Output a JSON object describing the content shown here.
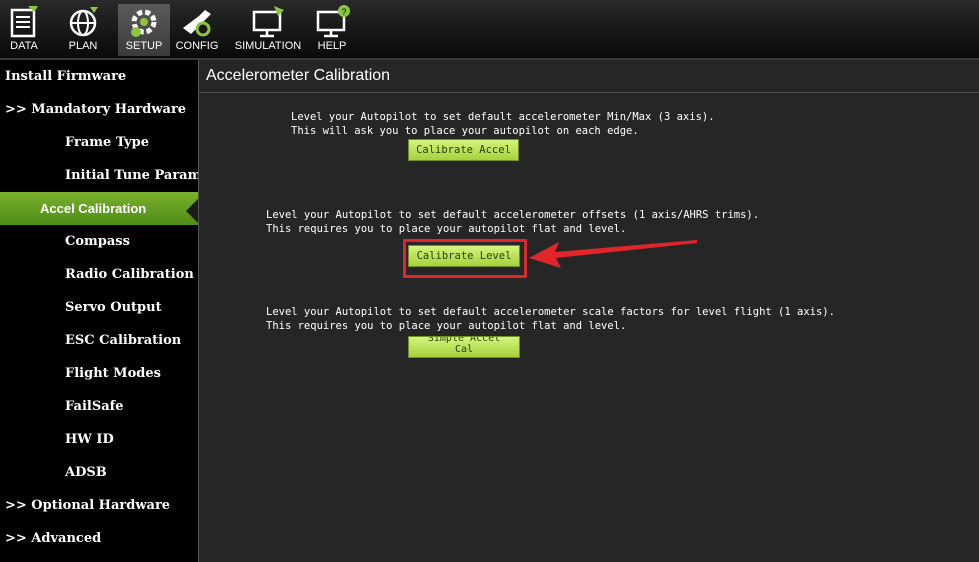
{
  "toolbar": {
    "items": [
      {
        "label": "DATA",
        "icon": "data-icon"
      },
      {
        "label": "PLAN",
        "icon": "plan-globe-icon"
      },
      {
        "label": "SETUP",
        "icon": "setup-gear-icon",
        "active": true
      },
      {
        "label": "CONFIG",
        "icon": "config-wrench-icon"
      },
      {
        "label": "SIMULATION",
        "icon": "simulation-monitor-icon"
      },
      {
        "label": "HELP",
        "icon": "help-monitor-icon"
      }
    ]
  },
  "sidebar": {
    "items": [
      {
        "label": "Install Firmware"
      },
      {
        "label": ">> Mandatory Hardware"
      },
      {
        "label": "Frame Type"
      },
      {
        "label": "Initial Tune Parameters"
      },
      {
        "label": "Accel Calibration",
        "active": true
      },
      {
        "label": "Compass"
      },
      {
        "label": "Radio Calibration"
      },
      {
        "label": "Servo Output"
      },
      {
        "label": "ESC Calibration"
      },
      {
        "label": "Flight Modes"
      },
      {
        "label": "FailSafe"
      },
      {
        "label": "HW ID"
      },
      {
        "label": "ADSB"
      },
      {
        "label": ">> Optional Hardware"
      },
      {
        "label": ">> Advanced"
      }
    ]
  },
  "main": {
    "title": "Accelerometer Calibration",
    "section1": {
      "line1": "Level your Autopilot to set default accelerometer Min/Max (3 axis).",
      "line2": "This will ask you to place your autopilot on each edge.",
      "button": "Calibrate Accel"
    },
    "section2": {
      "line1": "Level your Autopilot to set default accelerometer offsets (1 axis/AHRS trims).",
      "line2": "This requires you to place your autopilot flat and level.",
      "button": "Calibrate Level"
    },
    "section3": {
      "line1": "Level your Autopilot to set default accelerometer scale factors for level flight (1 axis).",
      "line2": "This requires you to place your autopilot flat and level.",
      "button_line1": "Simple Accel",
      "button_line2": "Cal"
    }
  },
  "colors": {
    "accent_green": "#6aa527",
    "button_green": "#b9e05a",
    "highlight_red": "#e0262a",
    "panel_bg": "#262626"
  }
}
